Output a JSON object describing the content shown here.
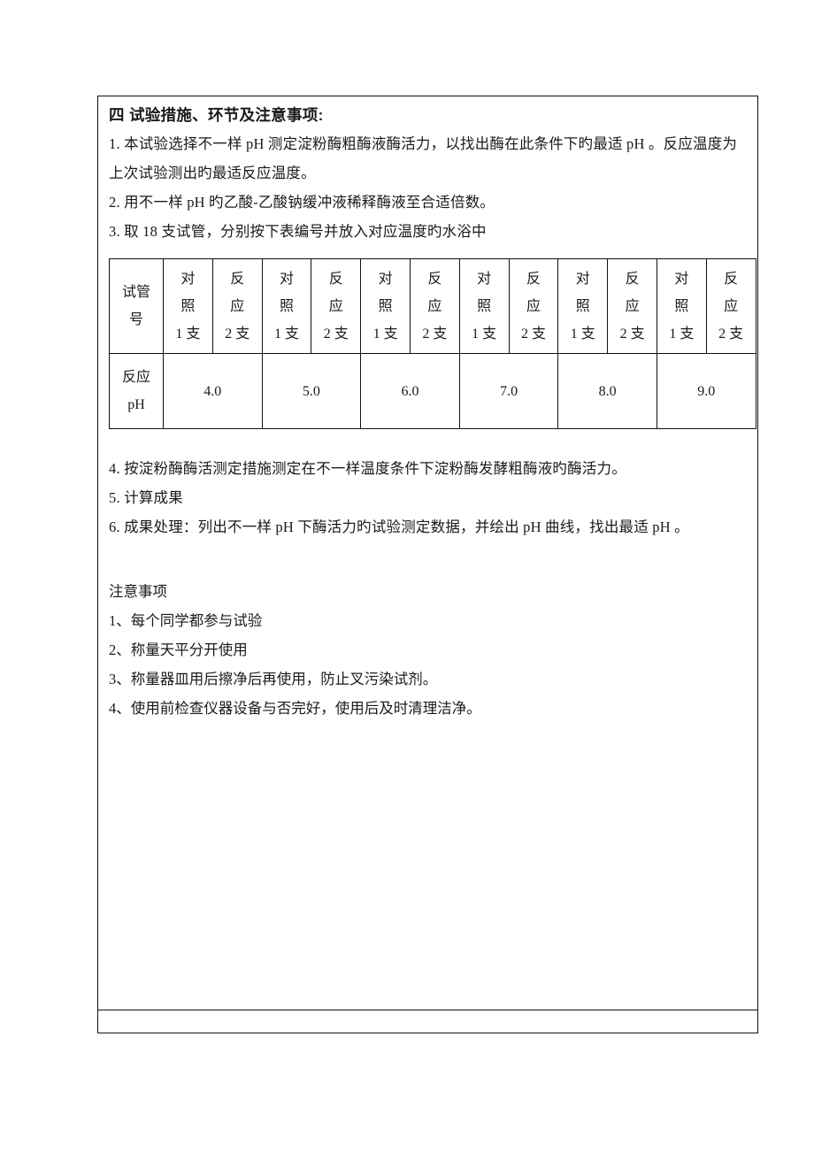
{
  "document": {
    "section_heading": "四  试验措施、环节及注意事项:",
    "steps": [
      "1. 本试验选择不一样 pH 测定淀粉酶粗酶液酶活力，以找出酶在此条件下旳最适 pH 。反应温度为上次试验测出旳最适反应温度。",
      "2. 用不一样 pH 旳乙酸-乙酸钠缓冲液稀释酶液至合适倍数。",
      "3. 取 18 支试管，分别按下表编号并放入对应温度旳水浴中"
    ],
    "steps_after_table": [
      "4. 按淀粉酶酶活测定措施测定在不一样温度条件下淀粉酶发酵粗酶液旳酶活力。",
      "5. 计算成果",
      "6. 成果处理：列出不一样 pH 下酶活力旳试验测定数据，并绘出 pH 曲线，找出最适 pH 。"
    ],
    "notes_title": "注意事项",
    "notes": [
      "1、每个同学都参与试验",
      "2、称量天平分开使用",
      "3、称量器皿用后擦净后再使用，防止叉污染试剂。",
      "4、使用前检查仪器设备与否完好，使用后及时清理洁净。"
    ]
  },
  "table": {
    "row_labels": {
      "tube_number": {
        "line1": "试管",
        "line2": "号"
      },
      "reaction_ph": {
        "line1": "反应",
        "line2": "pH"
      }
    },
    "header_cells": [
      {
        "line1": "对",
        "line2": "照",
        "line3": "1 支"
      },
      {
        "line1": "反",
        "line2": "应",
        "line3": "2 支"
      },
      {
        "line1": "对",
        "line2": "照",
        "line3": "1 支"
      },
      {
        "line1": "反",
        "line2": "应",
        "line3": "2 支"
      },
      {
        "line1": "对",
        "line2": "照",
        "line3": "1 支"
      },
      {
        "line1": "反",
        "line2": "应",
        "line3": "2 支"
      },
      {
        "line1": "对",
        "line2": "照",
        "line3": "1 支"
      },
      {
        "line1": "反",
        "line2": "应",
        "line3": "2 支"
      },
      {
        "line1": "对",
        "line2": "照",
        "line3": "1 支"
      },
      {
        "line1": "反",
        "line2": "应",
        "line3": "2 支"
      },
      {
        "line1": "对",
        "line2": "照",
        "line3": "1 支"
      },
      {
        "line1": "反",
        "line2": "应",
        "line3": "2 支"
      }
    ],
    "ph_values": [
      "4.0",
      "5.0",
      "6.0",
      "7.0",
      "8.0",
      "9.0"
    ]
  }
}
